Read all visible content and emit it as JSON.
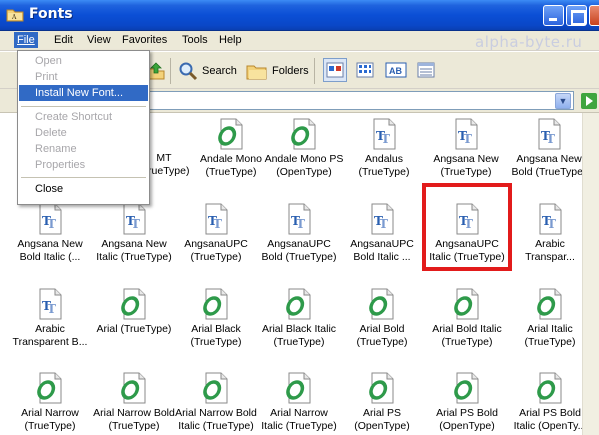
{
  "window": {
    "title": "Fonts"
  },
  "menu": {
    "items": [
      "File",
      "Edit",
      "View",
      "Favorites",
      "Tools",
      "Help"
    ],
    "active": "File"
  },
  "toolbar": {
    "search_label": "Search",
    "folders_label": "Folders",
    "view_label": "AB"
  },
  "watermark": "alpha-byte.ru",
  "file_menu": {
    "items": [
      {
        "label": "Open",
        "state": "disabled"
      },
      {
        "label": "Print",
        "state": "disabled"
      },
      {
        "label": "Install New Font...",
        "state": "selected"
      },
      {
        "label": "Create Shortcut",
        "state": "disabled"
      },
      {
        "label": "Delete",
        "state": "disabled"
      },
      {
        "label": "Rename",
        "state": "disabled"
      },
      {
        "label": "Properties",
        "state": "disabled"
      },
      {
        "label": "Close",
        "state": "enabled"
      }
    ]
  },
  "fonts": {
    "row1": [
      {
        "name": "MT",
        "type": "(TrueType)",
        "icon": "truetype-icon",
        "partial": true
      },
      {
        "name": "Andale Mono",
        "type": "(TrueType)",
        "icon": "opentype-icon"
      },
      {
        "name": "Andale Mono PS",
        "type": "(OpenType)",
        "icon": "opentype-icon"
      },
      {
        "name": "Andalus",
        "type": "(TrueType)",
        "icon": "truetype-icon"
      },
      {
        "name": "Angsana New",
        "type": "(TrueType)",
        "icon": "truetype-icon"
      },
      {
        "name": "Angsana New",
        "type": "Bold (TrueType)",
        "icon": "truetype-icon"
      }
    ],
    "row2": [
      {
        "name": "Angsana New",
        "type": "Bold Italic (...",
        "icon": "truetype-icon"
      },
      {
        "name": "Angsana New",
        "type": "Italic (TrueType)",
        "icon": "truetype-icon"
      },
      {
        "name": "AngsanaUPC",
        "type": "(TrueType)",
        "icon": "truetype-icon"
      },
      {
        "name": "AngsanaUPC",
        "type": "Bold (TrueType)",
        "icon": "truetype-icon"
      },
      {
        "name": "AngsanaUPC",
        "type": "Bold Italic ...",
        "icon": "truetype-icon"
      },
      {
        "name": "AngsanaUPC",
        "type": "Italic (TrueType)",
        "icon": "truetype-icon",
        "highlighted": true
      },
      {
        "name": "Arabic",
        "type": "Transpar...",
        "icon": "truetype-icon"
      }
    ],
    "row3": [
      {
        "name": "Arabic",
        "type": "Transparent B...",
        "icon": "truetype-icon"
      },
      {
        "name": "Arial (TrueType)",
        "type": "",
        "icon": "opentype-icon"
      },
      {
        "name": "Arial Black",
        "type": "(TrueType)",
        "icon": "opentype-icon"
      },
      {
        "name": "Arial Black Italic",
        "type": "(TrueType)",
        "icon": "opentype-icon"
      },
      {
        "name": "Arial Bold",
        "type": "(TrueType)",
        "icon": "opentype-icon"
      },
      {
        "name": "Arial Bold Italic",
        "type": "(TrueType)",
        "icon": "opentype-icon"
      },
      {
        "name": "Arial Italic",
        "type": "(TrueType)",
        "icon": "opentype-icon"
      }
    ],
    "row4": [
      {
        "name": "Arial Narrow",
        "type": "(TrueType)",
        "icon": "opentype-icon"
      },
      {
        "name": "Arial Narrow Bold",
        "type": "(TrueType)",
        "icon": "opentype-icon"
      },
      {
        "name": "Arial Narrow Bold",
        "type": "Italic (TrueType)",
        "icon": "opentype-icon"
      },
      {
        "name": "Arial Narrow",
        "type": "Italic (TrueType)",
        "icon": "opentype-icon"
      },
      {
        "name": "Arial PS",
        "type": "(OpenType)",
        "icon": "opentype-icon"
      },
      {
        "name": "Arial PS Bold",
        "type": "(OpenType)",
        "icon": "opentype-icon"
      },
      {
        "name": "Arial PS Bold",
        "type": "Italic (OpenTy...",
        "icon": "opentype-icon"
      }
    ]
  },
  "colors": {
    "titlebar": "#0b4fd6",
    "selection": "#316ac5",
    "highlight_box": "#e21b1b",
    "opentype_green": "#2e9a4a",
    "truetype_blue": "#2a5fb0"
  }
}
